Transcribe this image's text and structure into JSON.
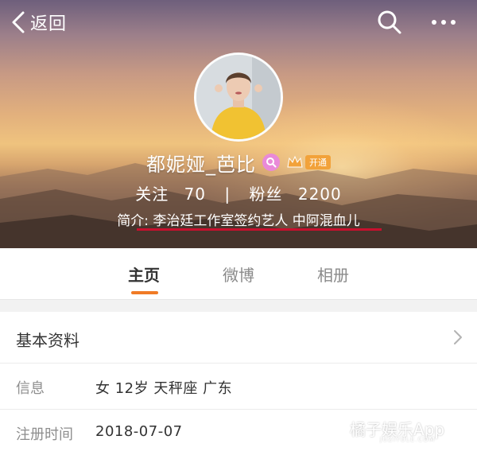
{
  "header": {
    "back_label": "返回",
    "name": "都妮娅_芭比",
    "vip_label": "开通",
    "stats": {
      "follow_label": "关注",
      "follow_count": "70",
      "divider": "|",
      "fans_label": "粉丝",
      "fans_count": "2200"
    },
    "intro": "简介: 李治廷工作室签约艺人 中阿混血儿"
  },
  "tabs": [
    "主页",
    "微博",
    "相册"
  ],
  "info": {
    "title": "基本资料",
    "rows": [
      {
        "key": "信息",
        "value": "女  12岁  天秤座  广东"
      },
      {
        "key": "注册时间",
        "value": "2018-07-07"
      }
    ]
  },
  "watermark": {
    "main": "橘子娱乐App",
    "sub": "JUZIYULE.COM"
  },
  "colors": {
    "accent": "#f07b26",
    "underline": "#c8102e",
    "vip": "#f2a23a",
    "badge": "#e98ad8"
  }
}
